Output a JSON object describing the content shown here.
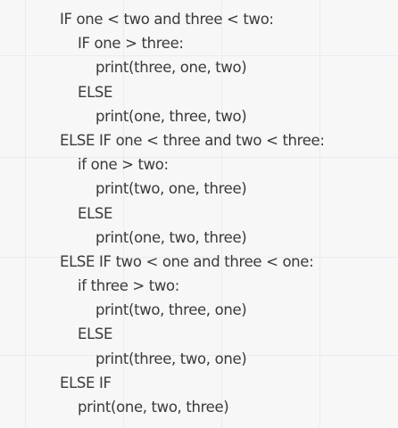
{
  "code": {
    "lines": [
      "IF one < two and three < two:",
      "IF one > three:",
      "print(three, one, two)",
      "ELSE",
      "print(one, three, two)",
      "ELSE IF one < three and two < three:",
      "if one > two:",
      "print(two, one, three)",
      "ELSE",
      "print(one, two, three)",
      "ELSE IF two < one and three < one:",
      "if three > two:",
      "print(two, three, one)",
      "ELSE",
      "print(three, two, one)",
      "ELSE IF",
      "print(one, two, three)"
    ]
  },
  "colors": {
    "background": "#f7f7f7",
    "text": "#3a3a3a",
    "grid": "#e9ecef"
  }
}
